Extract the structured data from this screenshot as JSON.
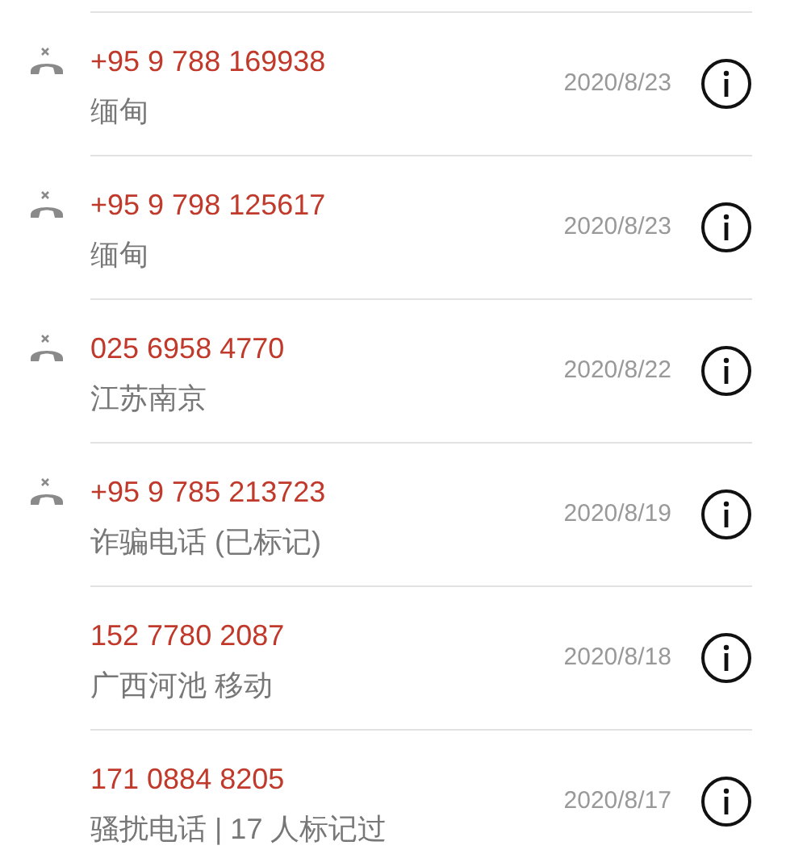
{
  "calls": [
    {
      "number": "+95 9 788 169938",
      "location": "缅甸",
      "date": "2020/8/23",
      "missed": true
    },
    {
      "number": "+95 9 798 125617",
      "location": "缅甸",
      "date": "2020/8/23",
      "missed": true
    },
    {
      "number": "025 6958 4770",
      "location": "江苏南京",
      "date": "2020/8/22",
      "missed": true
    },
    {
      "number": "+95 9 785 213723",
      "location": "诈骗电话 (已标记)",
      "date": "2020/8/19",
      "missed": true
    },
    {
      "number": "152 7780 2087",
      "location": "广西河池 移动",
      "date": "2020/8/18",
      "missed": false
    },
    {
      "number": "171 0884 8205",
      "location": "骚扰电话 | 17 人标记过",
      "date": "2020/8/17",
      "missed": false
    }
  ]
}
